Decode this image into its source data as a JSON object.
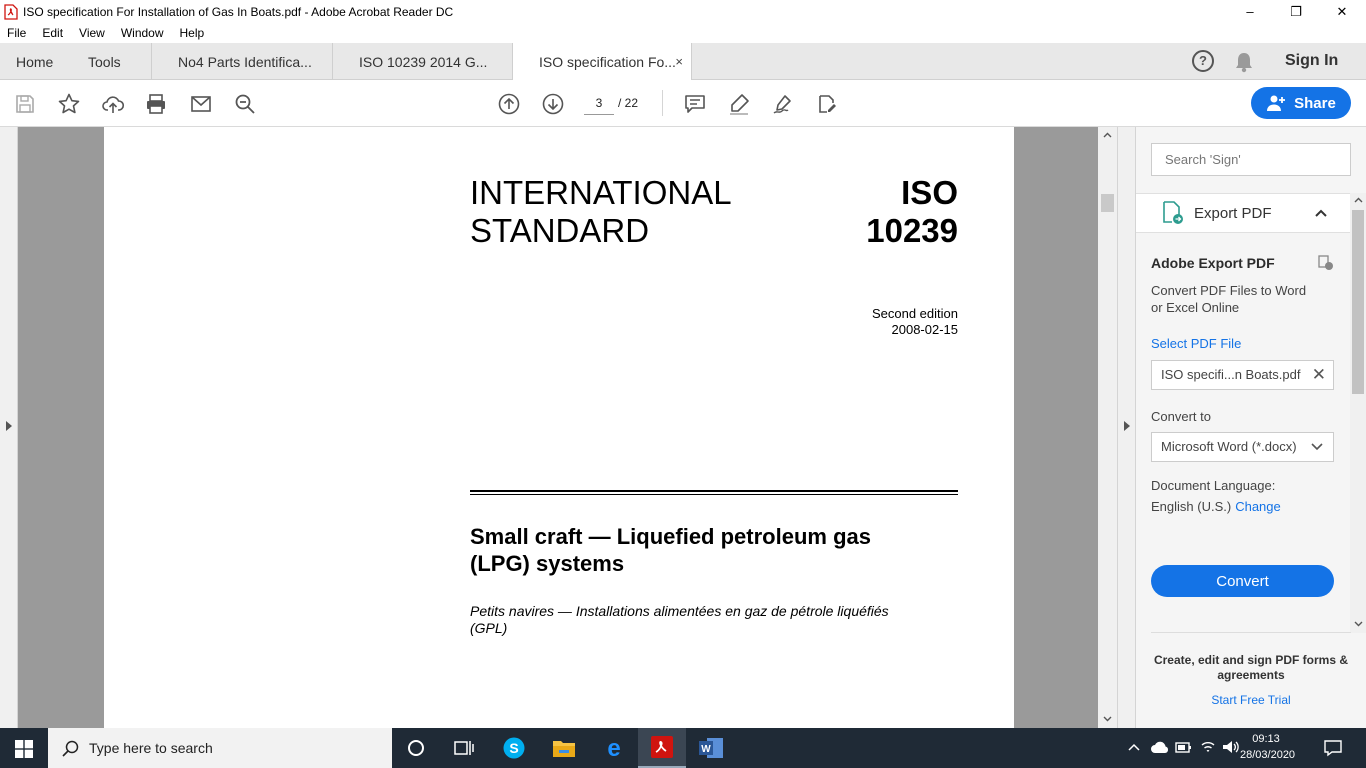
{
  "window": {
    "title": "ISO specification For Installation of Gas In Boats.pdf - Adobe Acrobat Reader DC",
    "minimize": "–",
    "maximize": "❐",
    "close": "✕"
  },
  "menu": [
    "File",
    "Edit",
    "View",
    "Window",
    "Help"
  ],
  "tabs": {
    "home": "Home",
    "tools": "Tools",
    "docs": [
      {
        "label": "No4 Parts Identifica..."
      },
      {
        "label": "ISO 10239 2014 G..."
      },
      {
        "label": "ISO specification Fo..."
      }
    ],
    "close_glyph": "×",
    "sign_in": "Sign In",
    "help_glyph": "?"
  },
  "toolbar": {
    "page_current": "3",
    "page_total": "/ 22",
    "share_label": "Share"
  },
  "document": {
    "heading_left_1": "INTERNATIONAL",
    "heading_left_2": "STANDARD",
    "heading_right_1": "ISO",
    "heading_right_2": "10239",
    "edition": "Second edition",
    "edition_date": "2008-02-15",
    "title_line_1": "Small craft — Liquefied petroleum gas",
    "title_line_2": "(LPG) systems",
    "subtitle_line_1": "Petits navires — Installations alimentées en gaz de pétrole liquéfiés",
    "subtitle_line_2": "(GPL)"
  },
  "right_pane": {
    "search_placeholder": "Search 'Sign'",
    "export_label": "Export PDF",
    "aep_title": "Adobe Export PDF",
    "aep_desc": "Convert PDF Files to Word or Excel Online",
    "select_pdf": "Select PDF File",
    "file_name": "ISO specifi...n Boats.pdf",
    "convert_to": "Convert to",
    "format": "Microsoft Word (*.docx)",
    "doc_language": "Document Language:",
    "language": "English (U.S.)",
    "change": "Change",
    "convert": "Convert",
    "promo": "Create, edit and sign PDF forms & agreements",
    "trial": "Start Free Trial"
  },
  "taskbar": {
    "search_placeholder": "Type here to search",
    "time": "09:13",
    "date": "28/03/2020"
  },
  "colors": {
    "accent": "#1473e6",
    "pdf_red": "#d0140f",
    "taskbar": "#1f2a36"
  }
}
